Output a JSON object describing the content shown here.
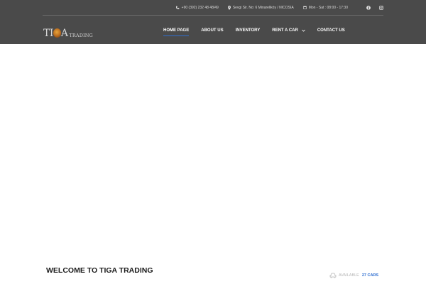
{
  "topbar": {
    "phone": "+90 (392) 232 48 48/49",
    "address": "Sevgi Sir. No: 6 Minareliköy / NICOSIA",
    "hours": "Mon - Sat : 08:00 - 17:30",
    "icons": [
      "phone-icon",
      "map-pin-icon",
      "calendar-icon",
      "facebook-icon",
      "instagram-icon"
    ]
  },
  "logo": {
    "main_left": "TI",
    "main_right": "A",
    "sub": "TRADING"
  },
  "nav": {
    "items": [
      {
        "label": "HOME PAGE",
        "active": true
      },
      {
        "label": "ABOUT US"
      },
      {
        "label": "INVENTORY"
      },
      {
        "label": "RENT A CAR",
        "has_dropdown": true
      },
      {
        "label": "CONTACT US"
      }
    ]
  },
  "main": {
    "welcome_title": "WELCOME TO TIGA TRADING",
    "available_label": "AVAILABLE",
    "available_count": "27 CARS"
  },
  "colors": {
    "header_bg": "#4a4a4a",
    "accent": "#2f6fd1"
  }
}
